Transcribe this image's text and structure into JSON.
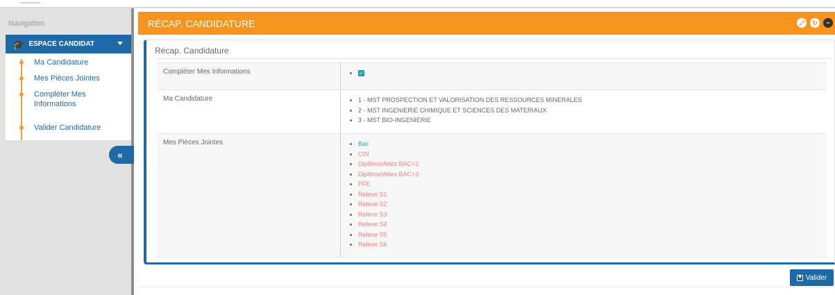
{
  "sidebar": {
    "nav_label": "Navigation",
    "section_label": "ESPACE CANDIDAT",
    "items": [
      {
        "label": "Ma Candidature"
      },
      {
        "label": "Mes Pièces Jointes"
      },
      {
        "label": "Compléter Mes Informations"
      },
      {
        "label": "Valider Candidature"
      }
    ],
    "collapse_glyph": "«"
  },
  "header": {
    "title": "RÉCAP. CANDIDATURE",
    "icons": [
      "expand-icon",
      "refresh-icon",
      "close-icon"
    ]
  },
  "panel": {
    "title": "Récap. Candidature",
    "rows": [
      {
        "label": "Compléter Mes Informations",
        "checked": true
      },
      {
        "label": "Ma Candidature",
        "items": [
          "1 - MST PROSPECTION ET VALORISATION DES RESSOURCES MINERALES",
          "2 - MST INGENIERIE CHIMIQUE ET SCIENCES DES MATERIAUX",
          "3 - MST BIO-INGENIERIE"
        ]
      },
      {
        "label": "Mes Pièces Jointes",
        "items": [
          {
            "name": "Bac",
            "status": "ok"
          },
          {
            "name": "CIN",
            "status": "missing"
          },
          {
            "name": "Diplôme/Attes BAC+2",
            "status": "missing"
          },
          {
            "name": "Diplôme/Attes BAC+3",
            "status": "missing"
          },
          {
            "name": "PFE",
            "status": "missing"
          },
          {
            "name": "Releve S1",
            "status": "missing"
          },
          {
            "name": "Releve S2",
            "status": "missing"
          },
          {
            "name": "Releve S3",
            "status": "missing"
          },
          {
            "name": "Releve S4",
            "status": "missing"
          },
          {
            "name": "Releve S5",
            "status": "missing"
          },
          {
            "name": "Releve S6",
            "status": "missing"
          }
        ]
      }
    ]
  },
  "footer": {
    "valider_label": "Valider"
  },
  "colors": {
    "accent": "#f7941d",
    "primary": "#1e6aa6",
    "ok": "#2aa3c4",
    "missing": "#f08080",
    "check": "#16a2b4"
  }
}
